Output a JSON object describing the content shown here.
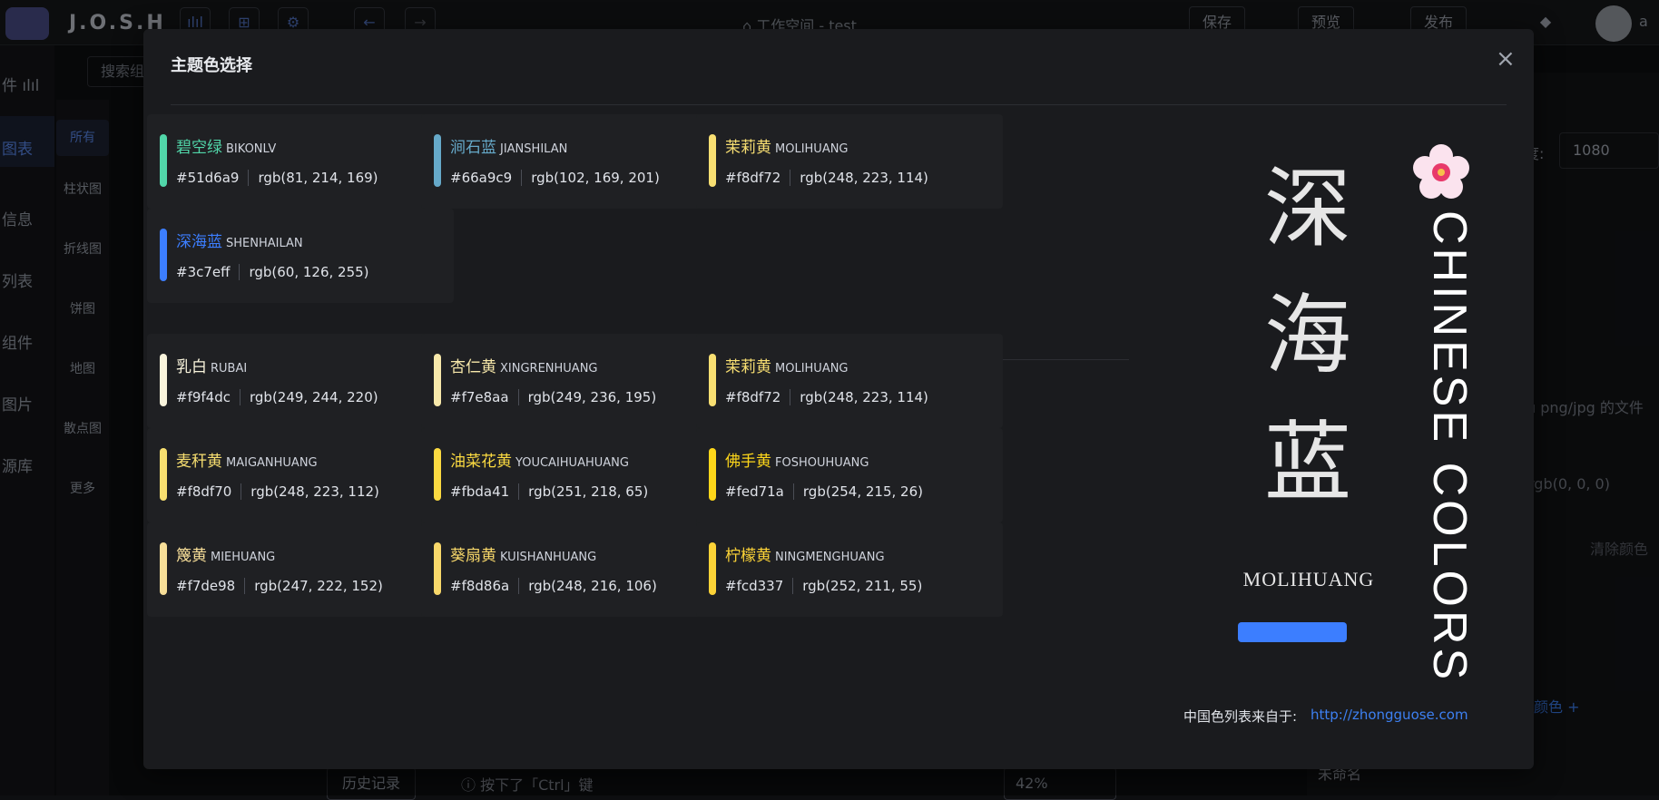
{
  "app": {
    "logo_text": "J.O.S.H",
    "workspace_title": "⌂ 工作空间 -   test",
    "actions": {
      "save": "保存",
      "preview": "预览",
      "publish": "发布"
    },
    "user_initial": "a"
  },
  "sidebar": {
    "items": [
      {
        "label": "图表",
        "active": true
      },
      {
        "label": "信息"
      },
      {
        "label": "列表"
      },
      {
        "label": "组件"
      },
      {
        "label": "图片"
      },
      {
        "label": "源库"
      }
    ],
    "top_label": "件 ılıl",
    "search_placeholder": "搜索组"
  },
  "subnav": {
    "items": [
      {
        "label": "所有",
        "active": true
      },
      {
        "label": "柱状图"
      },
      {
        "label": "折线图"
      },
      {
        "label": "饼图"
      },
      {
        "label": "地图"
      },
      {
        "label": "散点图"
      },
      {
        "label": "更多"
      }
    ]
  },
  "bottom": {
    "history_button": "历史记录",
    "hint": "ⓘ  按下了「Ctrl」键",
    "zoom": "42%"
  },
  "right_panel": {
    "width_value": "1080",
    "width_label": "度:",
    "file_hint": "u png/jpg 的文件",
    "bg_color": "rgb(0, 0, 0)",
    "clear_color": "清除颜色",
    "add_color": "颜色 +",
    "unnamed": "未命名"
  },
  "modal": {
    "title": "主题色选择",
    "close_icon": "×",
    "group1": [
      {
        "cn": "碧空绿",
        "py": "BIKONLV",
        "hex": "#51d6a9",
        "rgb": "rgb(81, 214, 169)"
      },
      {
        "cn": "涧石蓝",
        "py": "JIANSHILAN",
        "hex": "#66a9c9",
        "rgb": "rgb(102, 169, 201)"
      },
      {
        "cn": "茉莉黄",
        "py": "MOLIHUANG",
        "hex": "#f8df72",
        "rgb": "rgb(248, 223, 114)"
      },
      {
        "cn": "深海蓝",
        "py": "SHENHAILAN",
        "hex": "#3c7eff",
        "rgb": "rgb(60, 126, 255)"
      }
    ],
    "group2": [
      {
        "cn": "乳白",
        "py": "RUBAI",
        "hex": "#f9f4dc",
        "rgb": "rgb(249, 244, 220)"
      },
      {
        "cn": "杏仁黄",
        "py": "XINGRENHUANG",
        "hex": "#f7e8aa",
        "rgb": "rgb(249, 236, 195)"
      },
      {
        "cn": "茉莉黄",
        "py": "MOLIHUANG",
        "hex": "#f8df72",
        "rgb": "rgb(248, 223, 114)"
      },
      {
        "cn": "麦秆黄",
        "py": "MAIGANHUANG",
        "hex": "#f8df70",
        "rgb": "rgb(248, 223, 112)"
      },
      {
        "cn": "油菜花黄",
        "py": "YOUCAIHUAHUANG",
        "hex": "#fbda41",
        "rgb": "rgb(251, 218, 65)"
      },
      {
        "cn": "佛手黄",
        "py": "FOSHOUHUANG",
        "hex": "#fed71a",
        "rgb": "rgb(254, 215, 26)"
      },
      {
        "cn": "篾黄",
        "py": "MIEHUANG",
        "hex": "#f7de98",
        "rgb": "rgb(247, 222, 152)"
      },
      {
        "cn": "葵扇黄",
        "py": "KUISHANHUANG",
        "hex": "#f8d86a",
        "rgb": "rgb(248, 216, 106)"
      },
      {
        "cn": "柠檬黄",
        "py": "NINGMENGHUANG",
        "hex": "#fcd337",
        "rgb": "rgb(252, 211, 55)"
      }
    ],
    "preview": {
      "cn": "深海蓝",
      "py": "MOLIHUANG",
      "swatch_color": "#3c7eff",
      "vertical_text": "CHINESE COLORS",
      "flower_icon": "plum-blossom-icon"
    },
    "source_label": "中国色列表来自于:",
    "source_link": "http://zhongguose.com"
  }
}
